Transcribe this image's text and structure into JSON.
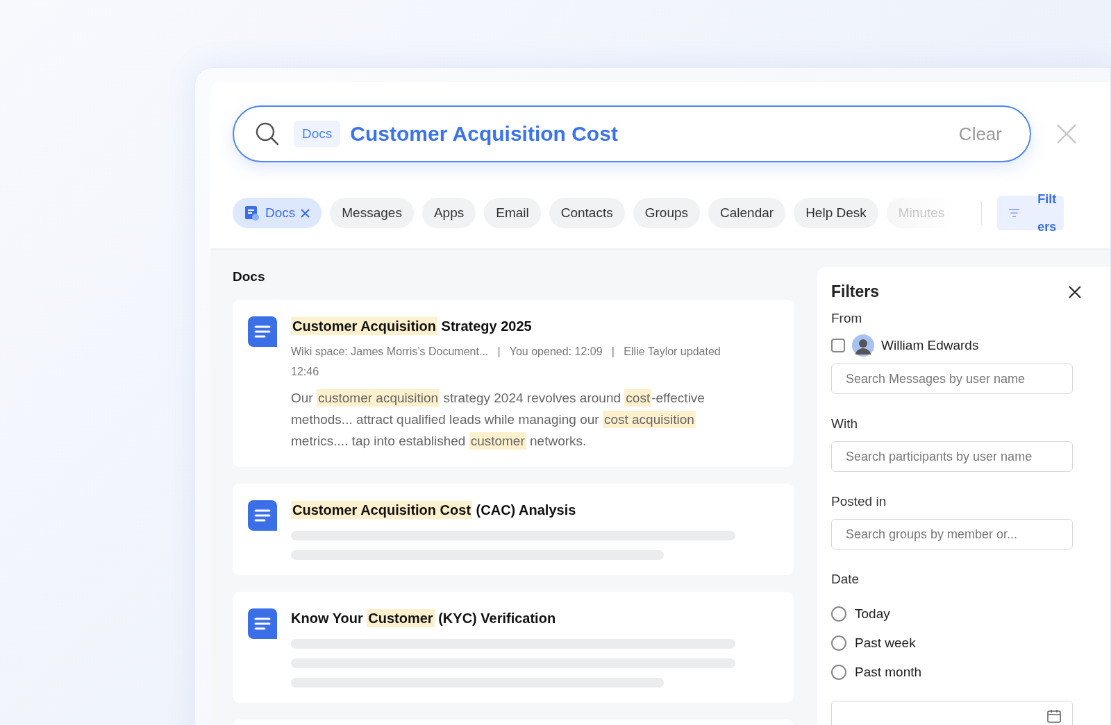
{
  "search": {
    "scope": "Docs",
    "value": "Customer Acquisition Cost",
    "clear": "Clear"
  },
  "chips": [
    {
      "label": "Docs",
      "selected": true,
      "faded": false
    },
    {
      "label": "Messages",
      "selected": false,
      "faded": false
    },
    {
      "label": "Apps",
      "selected": false,
      "faded": false
    },
    {
      "label": "Email",
      "selected": false,
      "faded": false
    },
    {
      "label": "Contacts",
      "selected": false,
      "faded": false
    },
    {
      "label": "Groups",
      "selected": false,
      "faded": false
    },
    {
      "label": "Calendar",
      "selected": false,
      "faded": false
    },
    {
      "label": "Help Desk",
      "selected": false,
      "faded": false
    },
    {
      "label": "Minutes",
      "selected": false,
      "faded": true
    }
  ],
  "filters_button": "Filters",
  "section_title": "Docs",
  "docs": [
    {
      "title": [
        {
          "text": "Customer Acquisition",
          "highlighted": true
        },
        {
          "text": " Strategy 2025",
          "highlighted": false
        }
      ],
      "meta": "Wiki space: James Morris’s Document...   |   You opened: 12:09   |   Ellie Taylor updated 12:46",
      "snippet": [
        {
          "text": "Our ",
          "highlighted": false
        },
        {
          "text": "customer acquisition",
          "highlighted": true
        },
        {
          "text": " strategy 2024 revolves around ",
          "highlighted": false
        },
        {
          "text": "cost",
          "highlighted": true
        },
        {
          "text": "-effective methods... attract qualified leads while managing our ",
          "highlighted": false
        },
        {
          "text": "cost acquisition",
          "highlighted": true
        },
        {
          "text": " metrics.... tap into established ",
          "highlighted": false
        },
        {
          "text": "customer",
          "highlighted": true
        },
        {
          "text": " networks.",
          "highlighted": false
        }
      ]
    },
    {
      "title": [
        {
          "text": "Customer Acquisition Cost",
          "highlighted": true
        },
        {
          "text": " (CAC) Analysis",
          "highlighted": false
        }
      ],
      "preview": [
        {
          "kind": "line"
        },
        {
          "kind": "short-line"
        }
      ]
    },
    {
      "title": [
        {
          "text": "Know Your ",
          "highlighted": false
        },
        {
          "text": "Customer",
          "highlighted": true
        },
        {
          "text": " (KYC) Verification",
          "highlighted": false
        }
      ],
      "preview": [
        {
          "kind": "line"
        },
        {
          "kind": "line"
        },
        {
          "kind": "short-line"
        }
      ]
    }
  ],
  "filters": {
    "title": "Filters",
    "from": {
      "label": "From",
      "person": {
        "name": "William Edwards",
        "checked": false
      },
      "placeholder": "Search Messages by user name"
    },
    "with": {
      "label": "With",
      "placeholder": "Search participants by user name"
    },
    "posted_in": {
      "label": "Posted in",
      "placeholder": "Search groups by member or..."
    },
    "date": {
      "label": "Date",
      "options": [
        {
          "label": "Today",
          "selected": false
        },
        {
          "label": "Past week",
          "selected": false
        },
        {
          "label": "Past month",
          "selected": false
        }
      ]
    }
  }
}
